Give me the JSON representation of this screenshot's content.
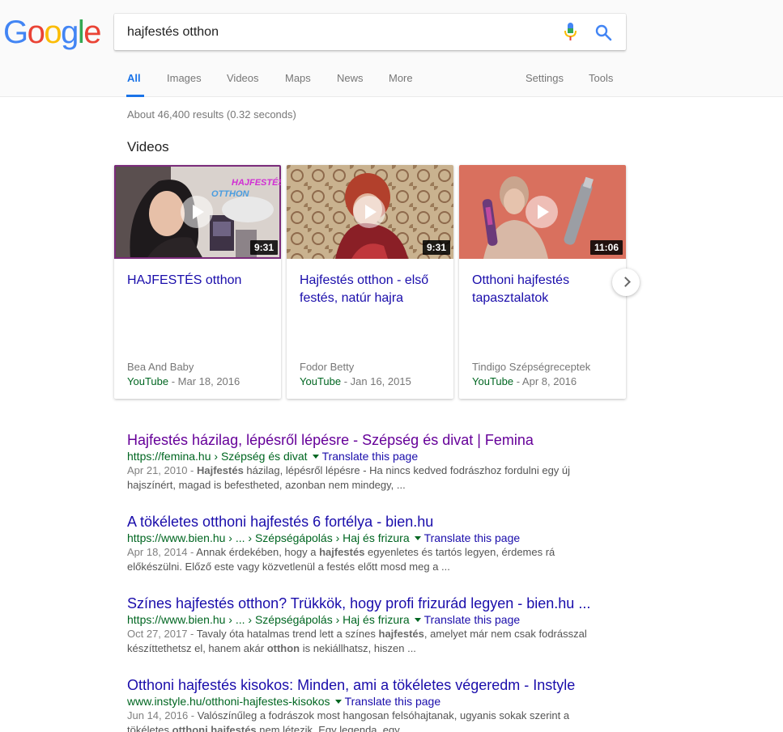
{
  "logo": {
    "text": "Google"
  },
  "search": {
    "query": "hajfestés otthon"
  },
  "tabs": [
    {
      "label": "All"
    },
    {
      "label": "Images"
    },
    {
      "label": "Videos"
    },
    {
      "label": "Maps"
    },
    {
      "label": "News"
    },
    {
      "label": "More"
    }
  ],
  "tools": {
    "settings": "Settings",
    "tools": "Tools"
  },
  "stats": "About 46,400 results (0.32 seconds)",
  "videos": {
    "heading": "Videos",
    "items": [
      {
        "title": "HAJFESTÉS otthon",
        "duration": "9:31",
        "channel": "Bea And Baby",
        "source": "YouTube",
        "date": " - Mar 18, 2016",
        "thumb_text_1": "HAJFESTÉS",
        "thumb_text_2": "OTTHON"
      },
      {
        "title": "Hajfestés otthon - első festés, natúr hajra",
        "duration": "9:31",
        "channel": "Fodor Betty",
        "source": "YouTube",
        "date": " - Jan 16, 2015"
      },
      {
        "title": "Otthoni hajfestés tapasztalatok",
        "duration": "11:06",
        "channel": "Tindigo Szépségreceptek",
        "source": "YouTube",
        "date": " - Apr 8, 2016"
      }
    ]
  },
  "results": [
    {
      "title": "Hajfestés házilag, lépésről lépésre - Szépség és divat | Femina",
      "url": "https://femina.hu › Szépség és divat",
      "translate": "Translate this page",
      "date": "Apr 21, 2010 - ",
      "s1_bold": "Hajfestés",
      "s1_rest": " házilag, lépésről lépésre - Ha nincs kedved fodrászhoz fordulni egy új",
      "s2": "hajszínért, magad is befestheted, azonban nem mindegy, ..."
    },
    {
      "title": "A tökéletes otthoni hajfestés 6 fortélya - bien.hu",
      "url": "https://www.bien.hu › ... › Szépségápolás › Haj és frizura",
      "translate": "Translate this page",
      "date": "Apr 18, 2014 - ",
      "s1_pre": "Annak érdekében, hogy a ",
      "s1_bold": "hajfestés",
      "s1_rest": " egyenletes és tartós legyen, érdemes rá",
      "s2": "előkészülni. Előző este vagy közvetlenül a festés előtt mosd meg a ..."
    },
    {
      "title": "Színes hajfestés otthon? Trükkök, hogy profi frizurád legyen - bien.hu ...",
      "url": "https://www.bien.hu › ... › Szépségápolás › Haj és frizura",
      "translate": "Translate this page",
      "date": "Oct 27, 2017 - ",
      "s1_pre": "Tavaly óta hatalmas trend lett a színes ",
      "s1_bold": "hajfestés",
      "s1_rest": ", amelyet már nem csak fodrásszal",
      "s2_pre": "készíttethetsz el, hanem akár ",
      "s2_bold": "otthon",
      "s2_rest": " is nekiállhatsz, hiszen ..."
    },
    {
      "title": "Otthoni hajfestés kisokos: Minden, ami a tökéletes végeredm - Instyle",
      "url": "www.instyle.hu/otthoni-hajfestes-kisokos",
      "translate": "Translate this page",
      "date": "Jun 14, 2016 - ",
      "s1_rest": "Valószínűleg a fodrászok most hangosan felsóhajtanak, ugyanis sokak szerint a",
      "s2_pre": "tökéletes ",
      "s2_bold": "otthoni hajfestés",
      "s2_rest": " nem létezik. Egy legenda, egy ..."
    }
  ],
  "colors": {
    "link": "#1a0dab",
    "visited": "#660099",
    "url": "#006621",
    "active_tab": "#1a73e8"
  }
}
